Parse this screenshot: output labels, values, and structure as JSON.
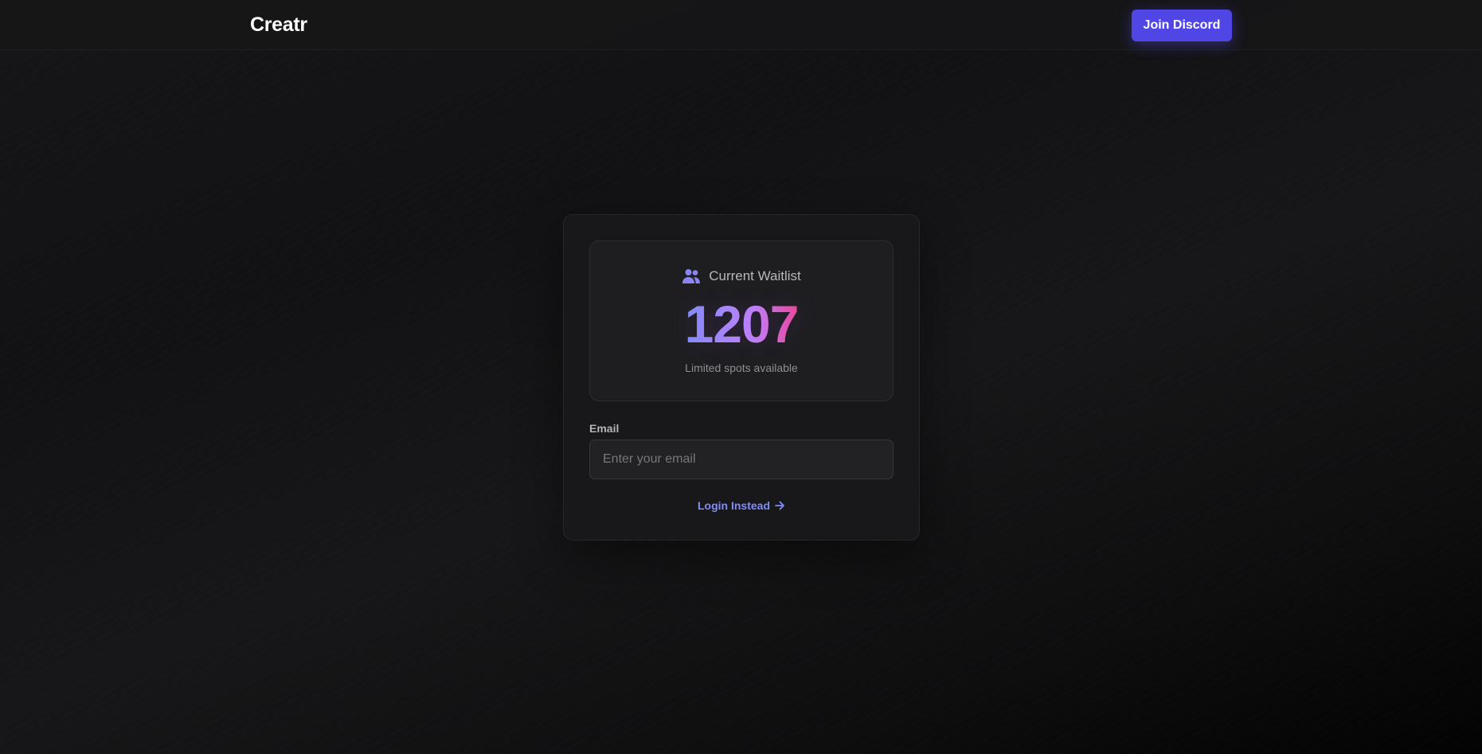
{
  "header": {
    "brand": "Creatr",
    "discord_button": "Join Discord"
  },
  "waitlist": {
    "title": "Current Waitlist",
    "icon": "users-icon",
    "count": "1207",
    "subtitle": "Limited spots available"
  },
  "form": {
    "email_label": "Email",
    "email_value": "",
    "email_placeholder": "Enter your email",
    "login_link": "Login Instead",
    "login_icon": "arrow-right-icon"
  },
  "colors": {
    "accent": "#4f46e5",
    "link": "#818cf8",
    "gradient_start": "#818cf8",
    "gradient_end": "#ec4899"
  }
}
